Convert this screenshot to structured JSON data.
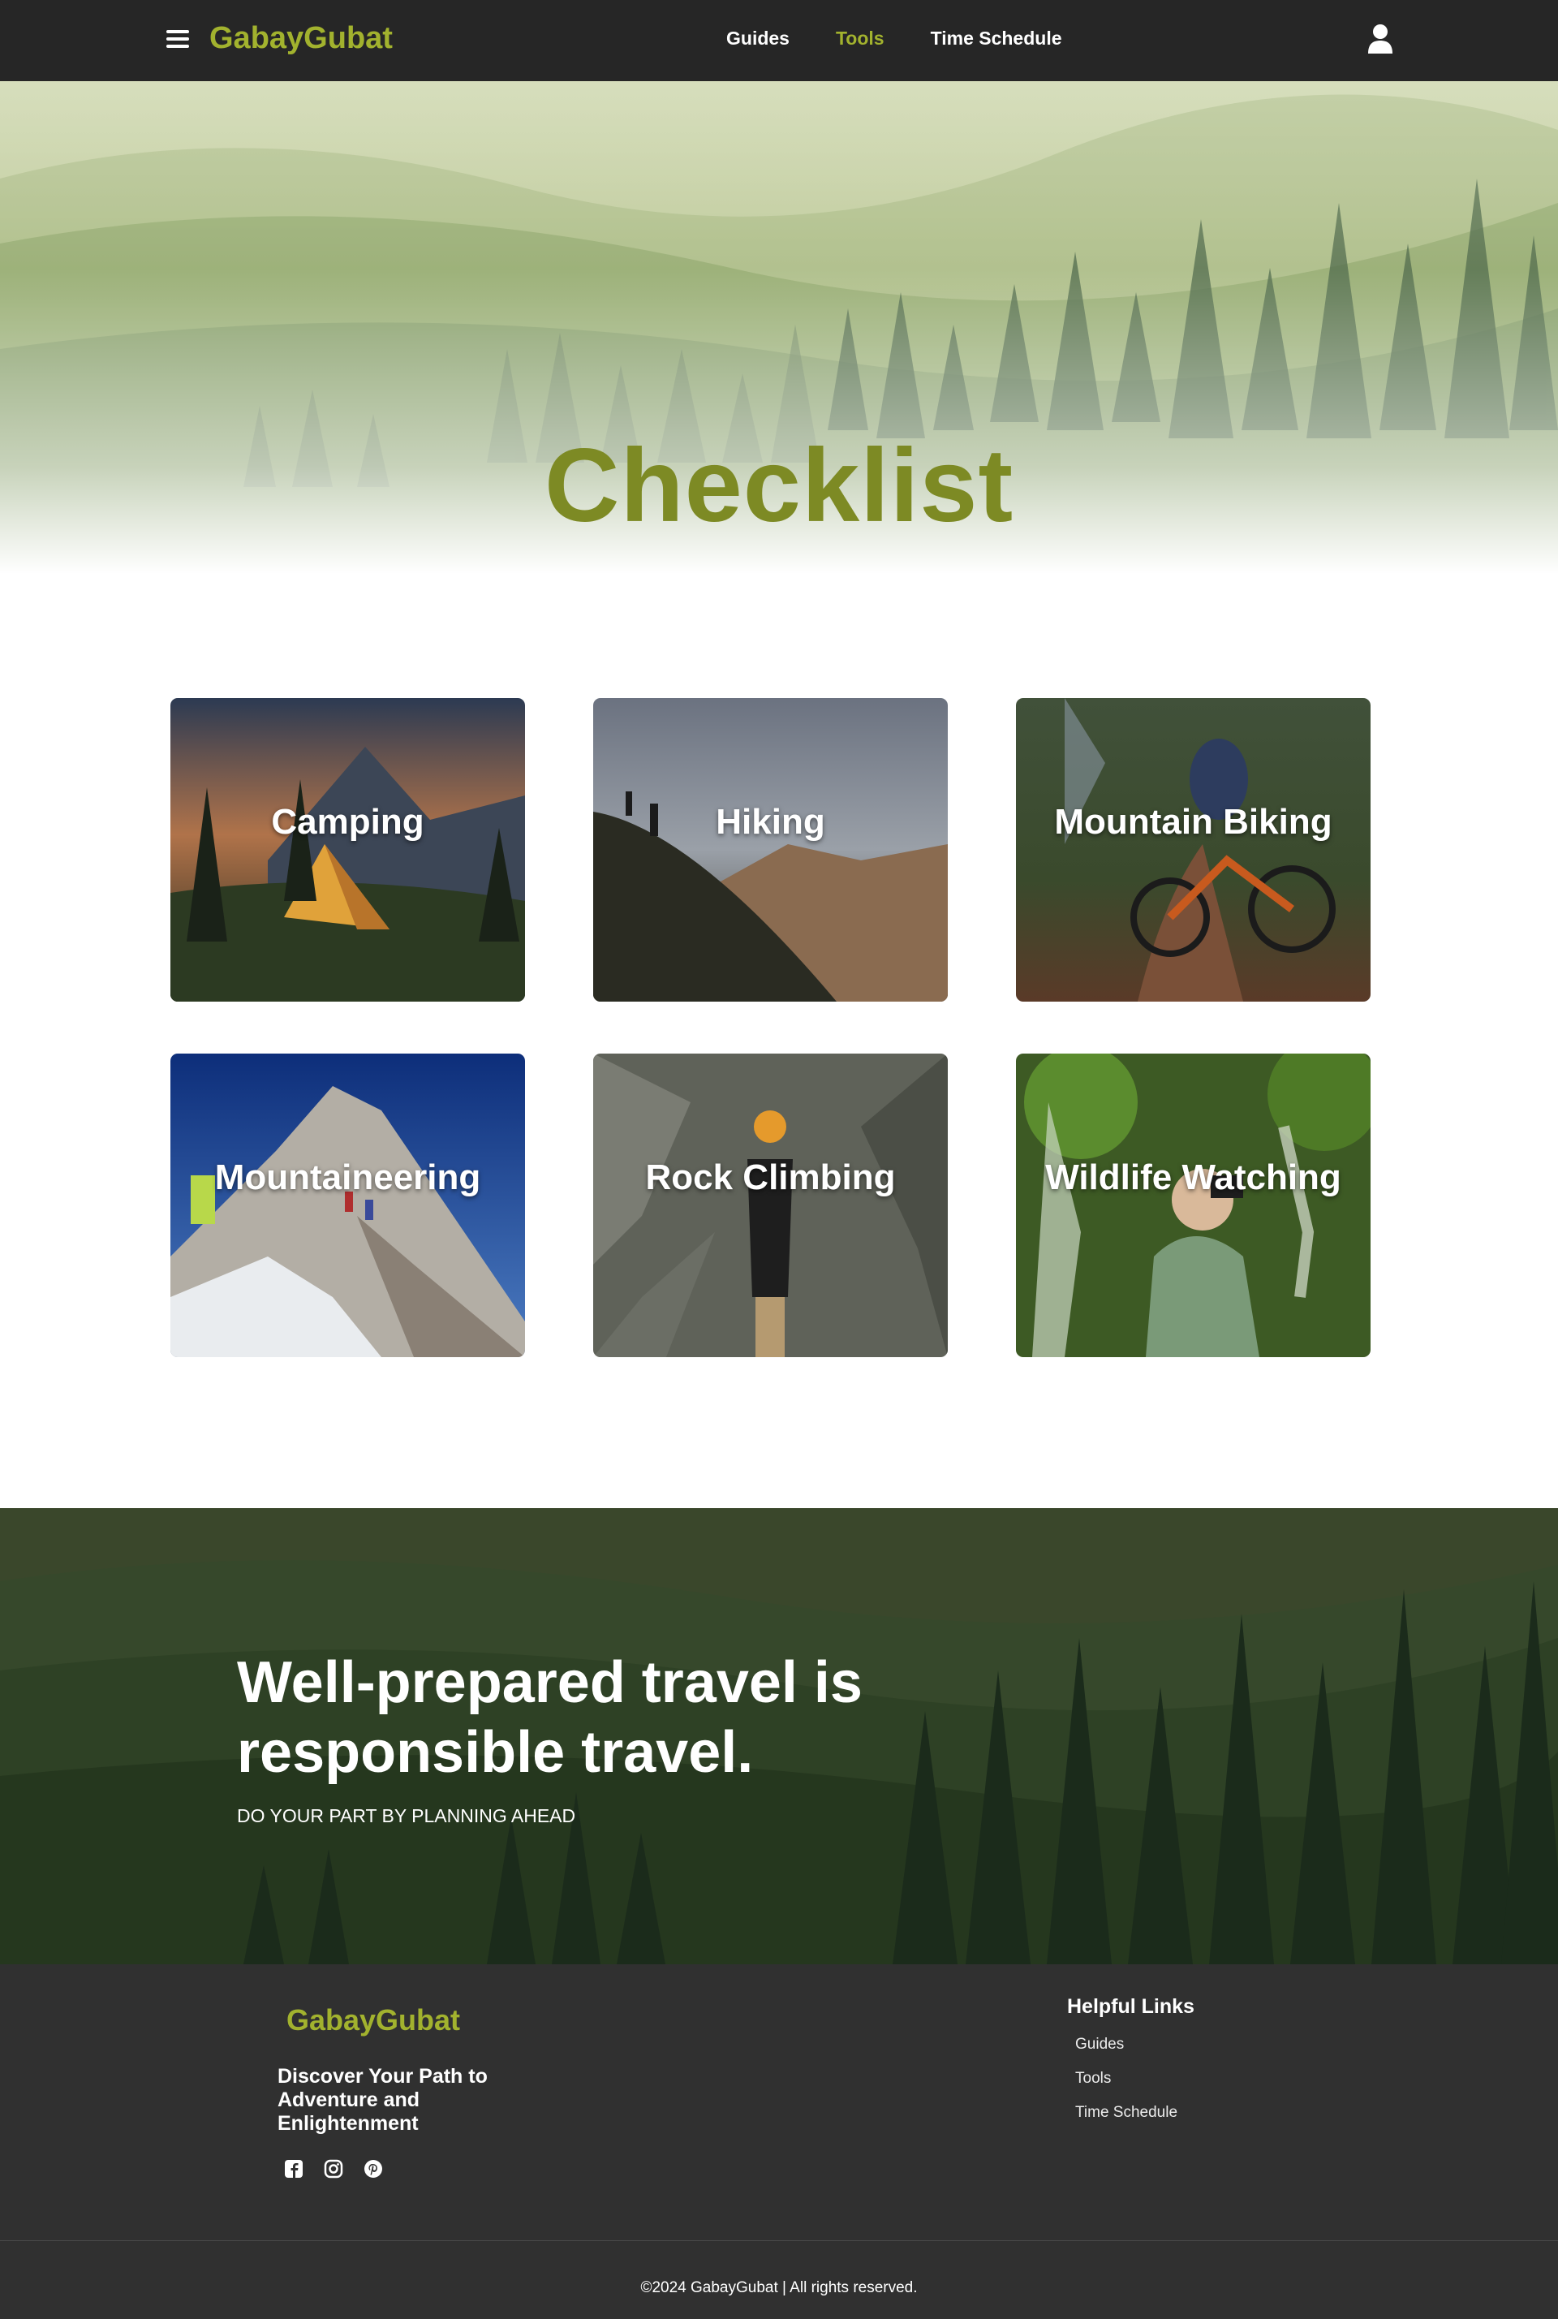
{
  "nav": {
    "brand": "GabayGubat",
    "links": [
      {
        "label": "Guides",
        "active": false
      },
      {
        "label": "Tools",
        "active": true
      },
      {
        "label": "Time Schedule",
        "active": false
      }
    ]
  },
  "hero": {
    "title": "Checklist"
  },
  "cards": [
    {
      "label": "Camping"
    },
    {
      "label": "Hiking"
    },
    {
      "label": "Mountain Biking"
    },
    {
      "label": "Mountaineering"
    },
    {
      "label": "Rock Climbing"
    },
    {
      "label": "Wildlife Watching"
    }
  ],
  "banner": {
    "title_line1": "Well-prepared travel is",
    "title_line2": "responsible travel.",
    "subtitle": "DO YOUR PART BY PLANNING AHEAD"
  },
  "footer": {
    "brand": "GabayGubat",
    "tagline": "Discover Your Path to Adventure and Enlightenment",
    "socials": [
      "facebook-icon",
      "instagram-icon",
      "pinterest-icon"
    ],
    "links_title": "Helpful Links",
    "links": [
      "Guides",
      "Tools",
      "Time Schedule"
    ],
    "copyright": "©2024 GabayGubat | All rights reserved."
  },
  "colors": {
    "brand": "#a2b22e",
    "title": "#7d8a24",
    "navbar": "#262626",
    "footer": "#303030"
  }
}
